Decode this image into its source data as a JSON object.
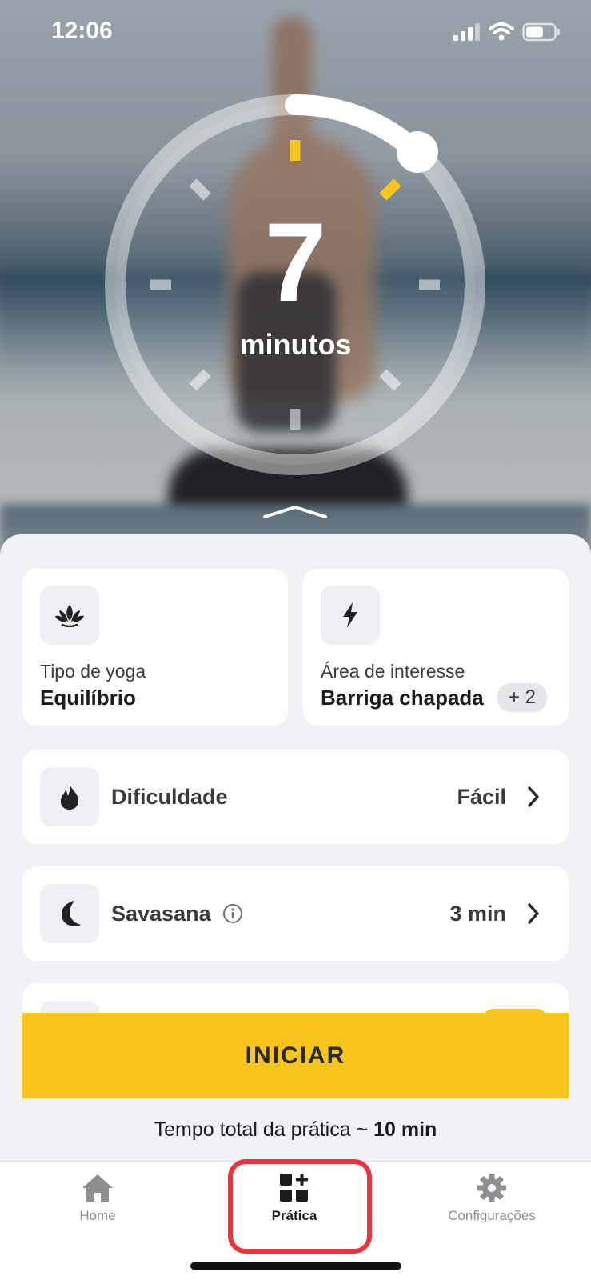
{
  "status_bar": {
    "time": "12:06"
  },
  "timer": {
    "value": "7",
    "unit": "minutos",
    "progress_fraction": 0.14
  },
  "cards": {
    "yoga_type": {
      "label": "Tipo de yoga",
      "value": "Equilíbrio",
      "icon": "lotus-icon"
    },
    "focus_area": {
      "label": "Área de interesse",
      "value": "Barriga chapada",
      "badge": "+ 2",
      "icon": "lightning-icon"
    }
  },
  "settings": [
    {
      "title": "Dificuldade",
      "value": "Fácil",
      "icon": "flame-icon"
    },
    {
      "title": "Savasana",
      "value": "3 min",
      "icon": "moon-icon"
    }
  ],
  "start_button": {
    "label": "INICIAR"
  },
  "total_time": {
    "prefix": "Tempo total da prática ~ ",
    "value": "10 min"
  },
  "tabs": [
    {
      "label": "Home",
      "icon": "house-icon"
    },
    {
      "label": "Prática",
      "icon": "grid-plus-icon",
      "active": true
    },
    {
      "label": "Configurações",
      "icon": "gear-icon"
    }
  ],
  "colors": {
    "accent": "#f7c51c",
    "highlight": "#f0323c"
  }
}
